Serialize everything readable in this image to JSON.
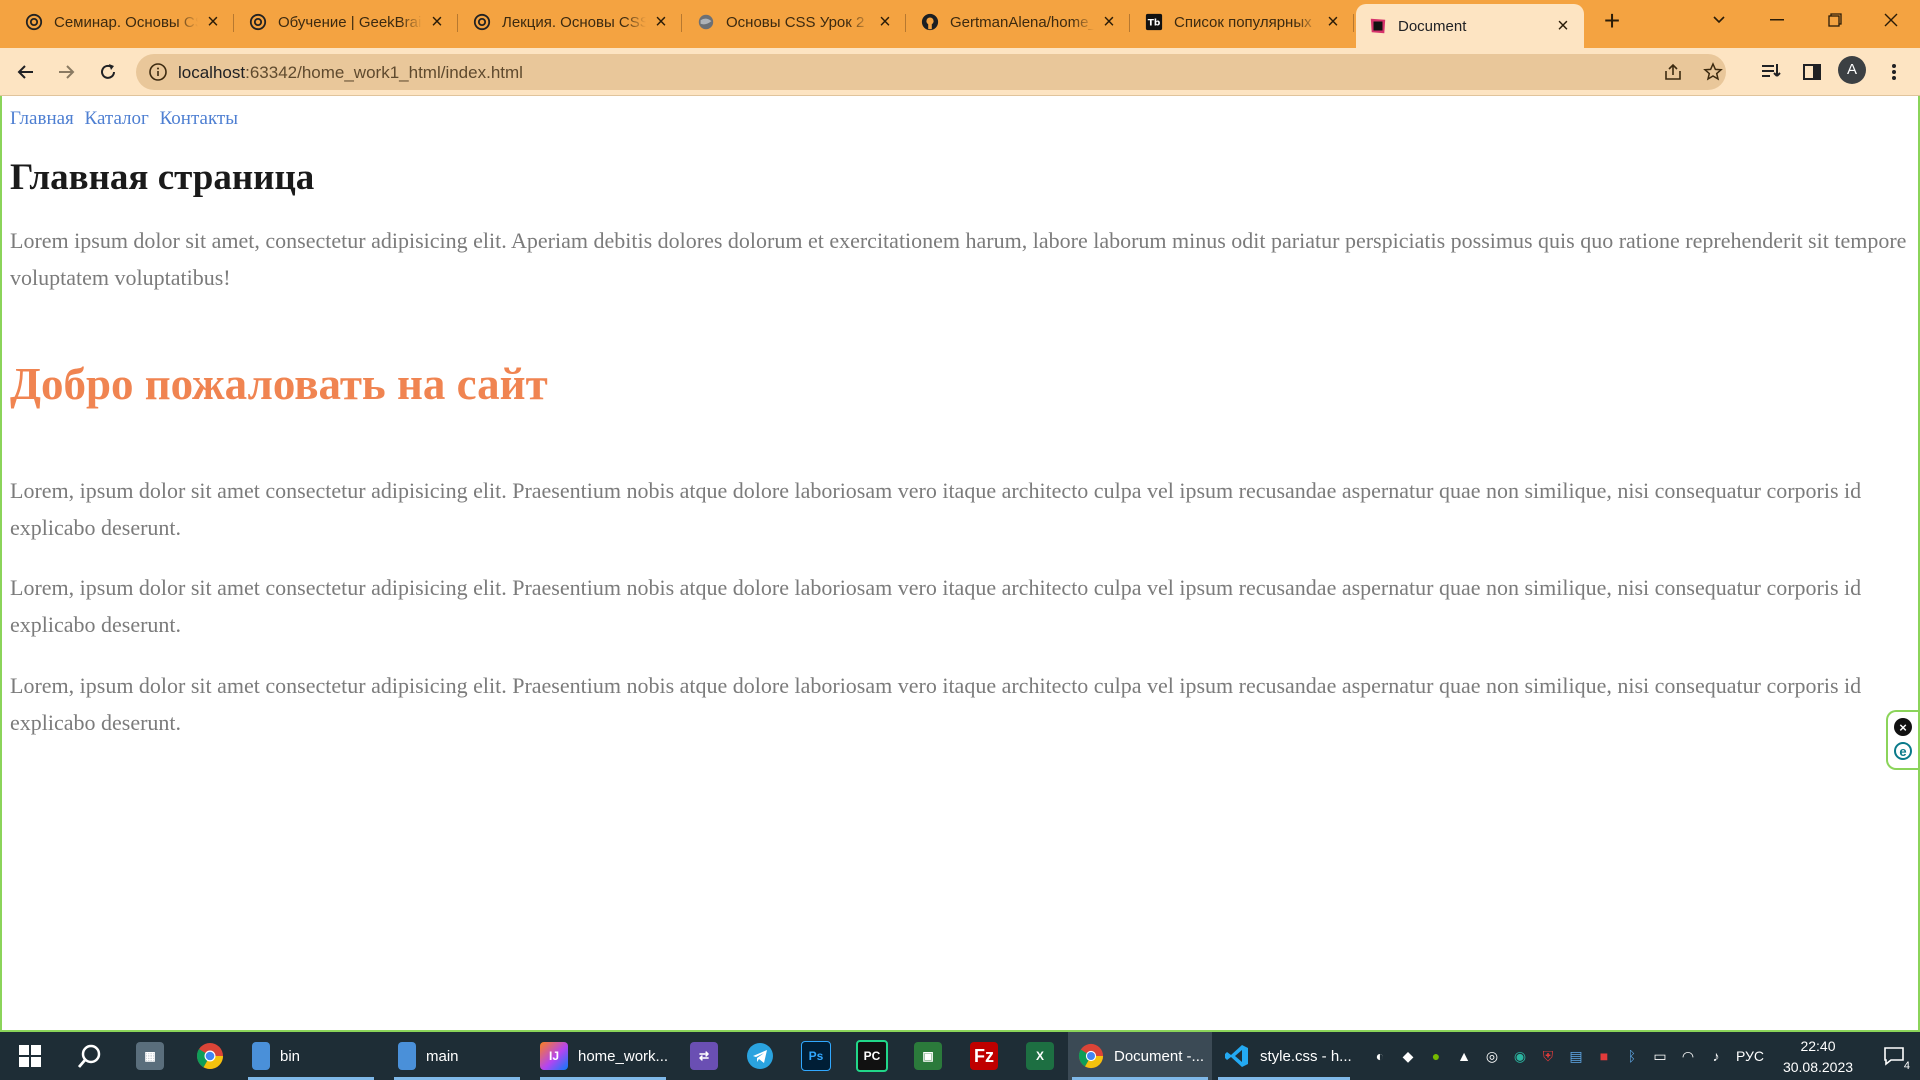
{
  "browser": {
    "tabs": [
      {
        "title": "Семинар. Основы CSS",
        "icon": "openai-icon"
      },
      {
        "title": "Обучение | GeekBrains",
        "icon": "openai-icon"
      },
      {
        "title": "Лекция. Основы CSS",
        "icon": "openai-icon"
      },
      {
        "title": "Основы CSS Урок 2",
        "icon": "globe-icon"
      },
      {
        "title": "GertmanAlena/home_",
        "icon": "github-icon"
      },
      {
        "title": "Список популярных",
        "icon": "tb-icon"
      },
      {
        "title": "Document",
        "icon": "jetbrains-icon",
        "active": true
      }
    ],
    "url_host": "localhost",
    "url_rest": ":63342/home_work1_html/index.html",
    "avatar_letter": "A"
  },
  "page": {
    "nav": [
      "Главная",
      "Каталог",
      "Контакты"
    ],
    "title": "Главная страница",
    "intro": "Lorem ipsum dolor sit amet, consectetur adipisicing elit. Aperiam debitis dolores dolorum et exercitationem harum, labore laborum minus odit pariatur perspiciatis possimus quis quo ratione reprehenderit sit tempore voluptatem voluptatibus!",
    "welcome": "Добро пожаловать на сайт",
    "paragraphs": [
      "Lorem, ipsum dolor sit amet consectetur adipisicing elit. Praesentium nobis atque dolore laboriosam vero itaque architecto culpa vel ipsum recusandae aspernatur quae non similique, nisi consequatur corporis id explicabo deserunt.",
      "Lorem, ipsum dolor sit amet consectetur adipisicing elit. Praesentium nobis atque dolore laboriosam vero itaque architecto culpa vel ipsum recusandae aspernatur quae non similique, nisi consequatur corporis id explicabo deserunt.",
      "Lorem, ipsum dolor sit amet consectetur adipisicing elit. Praesentium nobis atque dolore laboriosam vero itaque architecto culpa vel ipsum recusandae aspernatur quae non similique, nisi consequatur corporis id explicabo deserunt."
    ],
    "colors": {
      "link": "#4e7fd2",
      "welcome": "#f08451",
      "text": "#7b7b7b"
    }
  },
  "taskbar": {
    "items": [
      {
        "label": "bin",
        "icon": "folder-icon"
      },
      {
        "label": "main",
        "icon": "folder-icon"
      },
      {
        "label": "home_work...",
        "icon": "intellij-icon"
      },
      {
        "label": "Document -...",
        "icon": "chrome-icon"
      },
      {
        "label": "style.css - h...",
        "icon": "vscode-icon"
      }
    ],
    "pinned": [
      "telegram-icon",
      "photoshop-icon",
      "pycharm-icon",
      "filezilla-icon",
      "excel-icon"
    ],
    "lang": "РУС",
    "time": "22:40",
    "date": "30.08.2023",
    "notifications": "4"
  }
}
